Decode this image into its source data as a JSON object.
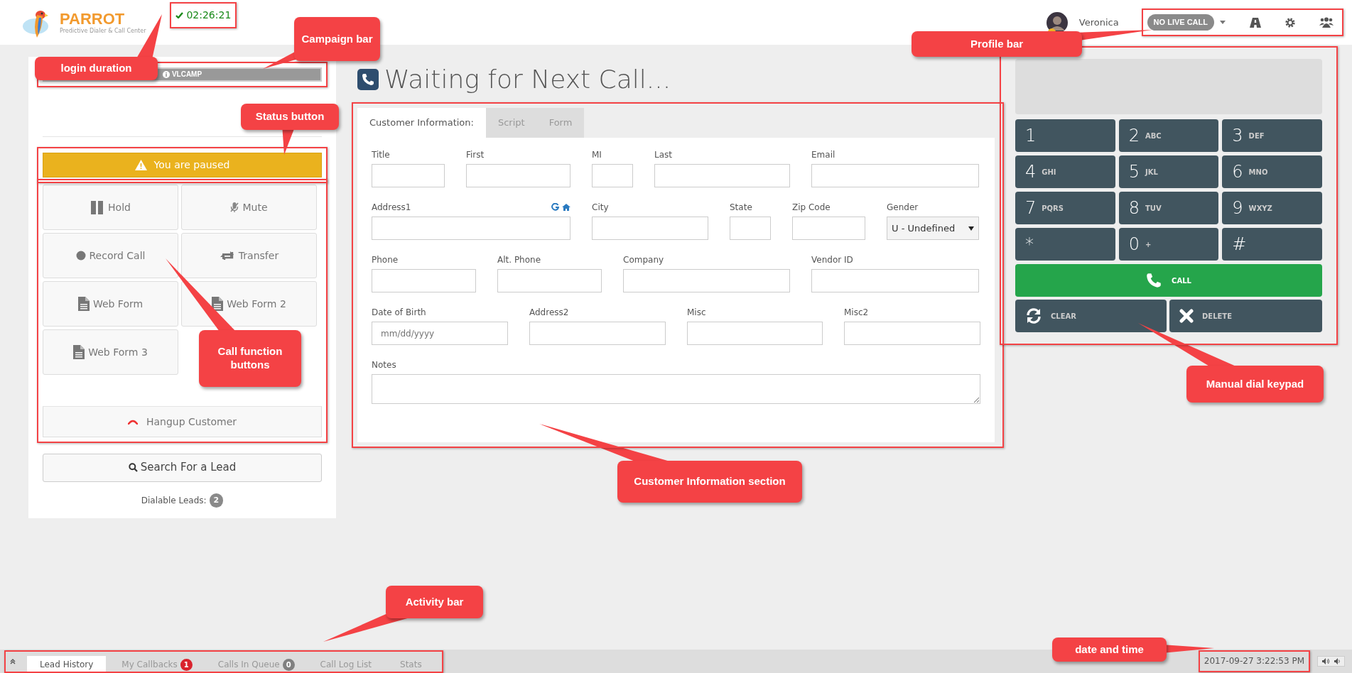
{
  "header": {
    "logo": {
      "name": "PARROT",
      "tagline": "Predictive Dialer & Call Center"
    },
    "login_timer": "02:26:21",
    "user": {
      "name": "Veronica",
      "online": true
    },
    "call_status": "NO LIVE CALL"
  },
  "left_panel": {
    "campaign": "VLCAMP",
    "status_button": "You are paused",
    "call_buttons": [
      {
        "label": "Hold",
        "kind": "hold"
      },
      {
        "label": "Mute",
        "kind": "mute"
      },
      {
        "label": "Record Call",
        "kind": "record"
      },
      {
        "label": "Transfer",
        "kind": "transfer"
      },
      {
        "label": "Web Form",
        "kind": "webform"
      },
      {
        "label": "Web Form 2",
        "kind": "webform"
      },
      {
        "label": "Web Form 3",
        "kind": "webform"
      }
    ],
    "hangup_button": "Hangup Customer",
    "search_button": "Search For a Lead",
    "dialable_leads": {
      "label": "Dialable Leads:",
      "count": "2"
    }
  },
  "main": {
    "title": "Waiting for Next Call...",
    "tabs": [
      {
        "label": "Customer Information:",
        "selected": true
      },
      {
        "label": "Script",
        "selected": false
      },
      {
        "label": "Form",
        "selected": false
      }
    ],
    "form": {
      "rows": [
        {
          "fields": [
            {
              "label": "Title",
              "kind": "text"
            },
            {
              "label": "First",
              "kind": "text"
            },
            {
              "label": "MI",
              "kind": "text"
            },
            {
              "label": "Last",
              "kind": "text"
            },
            {
              "label": "Email",
              "kind": "text"
            }
          ]
        },
        {
          "fields": [
            {
              "label": "Address1",
              "kind": "address"
            },
            {
              "label": "City",
              "kind": "text"
            },
            {
              "label": "State",
              "kind": "text"
            },
            {
              "label": "Zip Code",
              "kind": "text"
            },
            {
              "label": "Gender",
              "kind": "select",
              "value": "U - Undefined"
            }
          ]
        },
        {
          "fields": [
            {
              "label": "Phone",
              "kind": "text"
            },
            {
              "label": "Alt. Phone",
              "kind": "text"
            },
            {
              "label": "Company",
              "kind": "text"
            },
            {
              "label": "Vendor ID",
              "kind": "text"
            }
          ]
        },
        {
          "fields": [
            {
              "label": "Date of Birth",
              "kind": "text",
              "placeholder": "mm/dd/yyyy"
            },
            {
              "label": "Address2",
              "kind": "text"
            },
            {
              "label": "Misc",
              "kind": "text"
            },
            {
              "label": "Misc2",
              "kind": "text"
            }
          ]
        },
        {
          "fields": [
            {
              "label": "Notes",
              "kind": "textarea"
            }
          ]
        }
      ]
    }
  },
  "keypad": {
    "keys": [
      {
        "digit": "1"
      },
      {
        "digit": "2",
        "letters": "ABC"
      },
      {
        "digit": "3",
        "letters": "DEF"
      },
      {
        "digit": "4",
        "letters": "GHI"
      },
      {
        "digit": "5",
        "letters": "JKL"
      },
      {
        "digit": "6",
        "letters": "MNO"
      },
      {
        "digit": "7",
        "letters": "PQRS"
      },
      {
        "digit": "8",
        "letters": "TUV"
      },
      {
        "digit": "9",
        "letters": "WXYZ"
      },
      {
        "digit": "*"
      },
      {
        "digit": "0",
        "letters": "+"
      },
      {
        "digit": "#"
      }
    ],
    "call_button": "CALL",
    "clear_button": "CLEAR",
    "delete_button": "DELETE"
  },
  "bottom_bar": {
    "tabs": [
      {
        "label": "Lead History",
        "selected": true
      },
      {
        "label": "My Callbacks",
        "selected": false,
        "badge": {
          "text": "1",
          "color": "#d9232d"
        }
      },
      {
        "label": "Calls In Queue",
        "selected": false,
        "badge": {
          "text": "0",
          "color": "#808080"
        }
      },
      {
        "label": "Call Log List",
        "selected": false
      },
      {
        "label": "Stats",
        "selected": false
      }
    ],
    "datetime": "2017-09-27 3:22:53 PM"
  },
  "annotations": [
    {
      "text": "login duration"
    },
    {
      "text": "Campaign bar"
    },
    {
      "text": "Status button"
    },
    {
      "text": "Profile bar"
    },
    {
      "text": "Call function buttons"
    },
    {
      "text": "Customer Information section"
    },
    {
      "text": "Manual dial keypad"
    },
    {
      "text": "Activity bar"
    },
    {
      "text": "date and time"
    }
  ]
}
